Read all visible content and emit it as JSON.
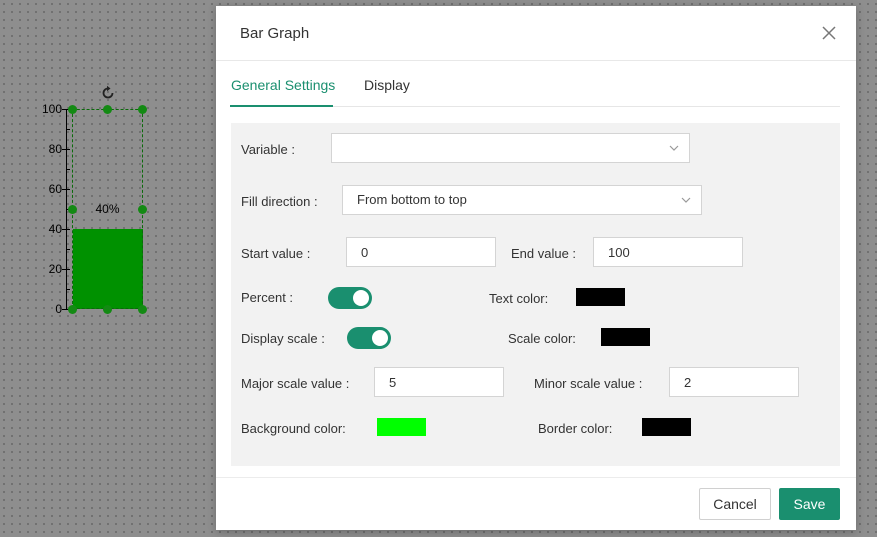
{
  "canvas": {
    "scale_labels": [
      "100",
      "80",
      "60",
      "40",
      "20",
      "0"
    ],
    "bar_value_text": "40%",
    "bar_fill_fraction": 0.4,
    "bar_fill_color": "#009100"
  },
  "modal": {
    "title": "Bar Graph",
    "close_icon": "close-icon",
    "tabs": [
      {
        "label": "General Settings",
        "active": true
      },
      {
        "label": "Display",
        "active": false
      }
    ],
    "form": {
      "variable_label": "Variable :",
      "variable_value": "",
      "fill_direction_label": "Fill direction :",
      "fill_direction_value": "From bottom to top",
      "start_value_label": "Start value :",
      "start_value": "0",
      "end_value_label": "End value :",
      "end_value": "100",
      "percent_label": "Percent :",
      "percent_on": true,
      "text_color_label": "Text color:",
      "text_color": "#000000",
      "display_scale_label": "Display scale :",
      "display_scale_on": true,
      "scale_color_label": "Scale color:",
      "scale_color": "#000000",
      "major_scale_label": "Major scale value :",
      "major_scale_value": "5",
      "minor_scale_label": "Minor scale value :",
      "minor_scale_value": "2",
      "background_color_label": "Background color:",
      "background_color": "#00ff00",
      "border_color_label": "Border color:",
      "border_color": "#000000"
    },
    "buttons": {
      "cancel": "Cancel",
      "save": "Save"
    },
    "accent_color": "#1a8f6f"
  }
}
